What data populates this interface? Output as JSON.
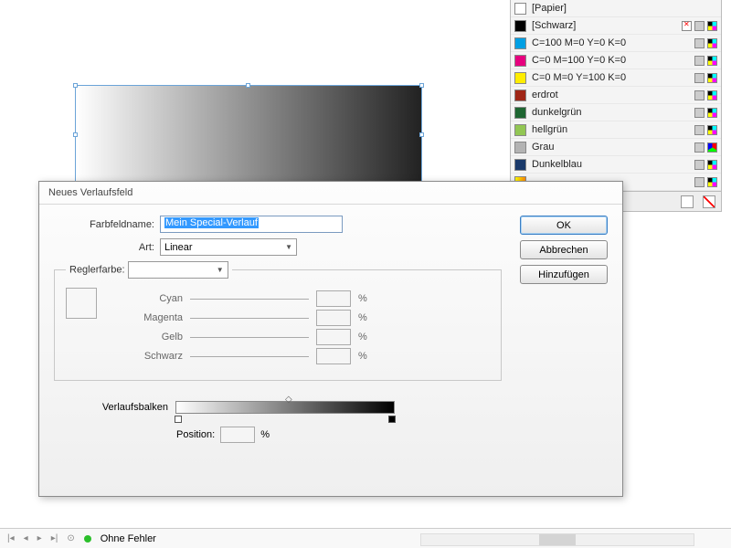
{
  "canvas": {
    "gradient": [
      "#ffffff",
      "#222222"
    ]
  },
  "swatches": {
    "items": [
      {
        "name": "[Papier]",
        "color": "#ffffff",
        "icons": ""
      },
      {
        "name": "[Schwarz]",
        "color": "#000000",
        "icons": "x"
      },
      {
        "name": "C=100 M=0 Y=0 K=0",
        "color": "#009fe3"
      },
      {
        "name": "C=0 M=100 Y=0 K=0",
        "color": "#e6007e"
      },
      {
        "name": "C=0 M=0 Y=100 K=0",
        "color": "#ffed00"
      },
      {
        "name": "erdrot",
        "color": "#a02616"
      },
      {
        "name": "dunkelgrün",
        "color": "#1e6632"
      },
      {
        "name": "hellgrün",
        "color": "#92c653"
      },
      {
        "name": "Grau",
        "color": "#b3b3b3"
      },
      {
        "name": "Dunkelblau",
        "color": "#1a3a6b"
      },
      {
        "name": "",
        "color": "linear"
      }
    ]
  },
  "dialog": {
    "title": "Neues Verlaufsfeld",
    "fields": {
      "name_label": "Farbfeldname:",
      "name_value": "Mein Special-Verlauf",
      "type_label": "Art:",
      "type_value": "Linear",
      "stopcolor_label": "Reglerfarbe:",
      "stopcolor_value": ""
    },
    "cmyk": {
      "cyan": "Cyan",
      "magenta": "Magenta",
      "yellow": "Gelb",
      "black": "Schwarz",
      "unit": "%"
    },
    "gradbar_label": "Verlaufsbalken",
    "position_label": "Position:",
    "position_unit": "%",
    "buttons": {
      "ok": "OK",
      "cancel": "Abbrechen",
      "add": "Hinzufügen"
    }
  },
  "statusbar": {
    "errors": "Ohne Fehler"
  }
}
